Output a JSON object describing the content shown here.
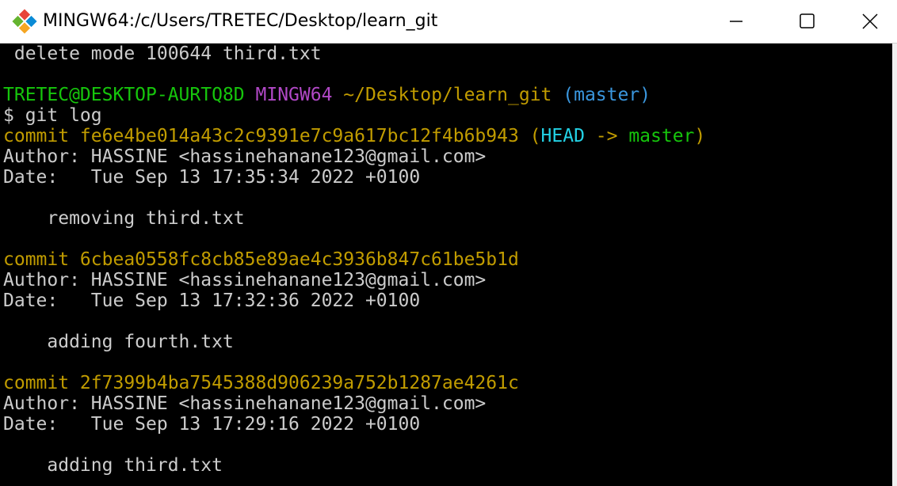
{
  "window": {
    "title": "MINGW64:/c/Users/TRETEC/Desktop/learn_git"
  },
  "terminal": {
    "line0": " delete mode 100644 third.txt",
    "prompt": {
      "user_host": "TRETEC@DESKTOP-AURTQ8D",
      "shell": "MINGW64",
      "path": "~/Desktop/learn_git",
      "branch": "(master)"
    },
    "command": "$ git log",
    "commits": [
      {
        "hash_line": "commit fe6e4be014a43c2c9391e7c9a617bc12f4b6b943",
        "ref_open": " (",
        "ref_head": "HEAD",
        "ref_arrow": " -> ",
        "ref_branch": "master",
        "ref_close": ")",
        "author": "Author: HASSINE <hassinehanane123@gmail.com>",
        "date": "Date:   Tue Sep 13 17:35:34 2022 +0100",
        "message": "    removing third.txt"
      },
      {
        "hash_line": "commit 6cbea0558fc8cb85e89ae4c3936b847c61be5b1d",
        "author": "Author: HASSINE <hassinehanane123@gmail.com>",
        "date": "Date:   Tue Sep 13 17:32:36 2022 +0100",
        "message": "    adding fourth.txt"
      },
      {
        "hash_line": "commit 2f7399b4ba7545388d906239a752b1287ae4261c",
        "author": "Author: HASSINE <hassinehanane123@gmail.com>",
        "date": "Date:   Tue Sep 13 17:29:16 2022 +0100",
        "message": "    adding third.txt"
      }
    ]
  },
  "colors": {
    "background": "#000000",
    "text": "#cccccc",
    "prompt_green": "#16c60c",
    "prompt_magenta": "#b148c6",
    "commit_yellow": "#c19c00",
    "branch_cyan": "#3a96dd",
    "head_cyan": "#23d2e6"
  },
  "icons": {
    "app": "git-diamond-icon",
    "minimize": "minimize-icon",
    "maximize": "maximize-icon",
    "close": "close-icon"
  }
}
